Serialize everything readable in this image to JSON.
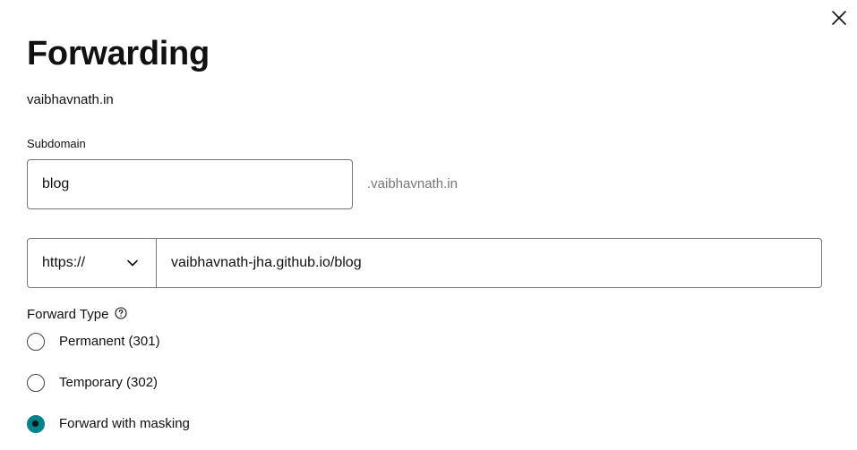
{
  "dialog": {
    "title": "Forwarding",
    "domain": "vaibhavnath.in"
  },
  "subdomain": {
    "label": "Subdomain",
    "value": "blog",
    "suffix": ".vaibhavnath.in"
  },
  "destination": {
    "protocol": "https://",
    "url": "vaibhavnath-jha.github.io/blog"
  },
  "forward_type": {
    "label": "Forward Type",
    "options": [
      {
        "label": "Permanent (301)",
        "selected": false
      },
      {
        "label": "Temporary (302)",
        "selected": false
      },
      {
        "label": "Forward with masking",
        "selected": true
      }
    ]
  },
  "colors": {
    "accent": "#00838c",
    "border": "#767676",
    "text": "#111111",
    "muted": "#767676"
  },
  "icons": {
    "close": "close-icon",
    "dropdown": "chevron-down-icon",
    "help": "help-circle-icon"
  }
}
